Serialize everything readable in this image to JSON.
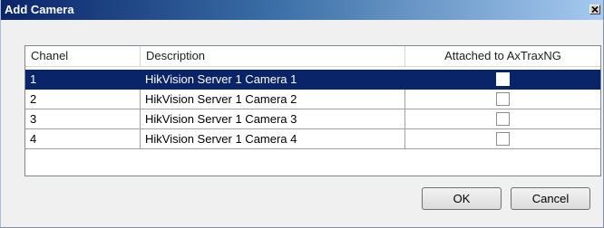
{
  "window": {
    "title": "Add Camera",
    "close_glyph": "×"
  },
  "grid": {
    "columns": [
      "Chanel",
      "Description",
      "Attached to AxTraxNG"
    ],
    "rows": [
      {
        "channel": "1",
        "description": "HikVision Server 1 Camera 1",
        "attached": false,
        "selected": true
      },
      {
        "channel": "2",
        "description": "HikVision Server 1 Camera 2",
        "attached": false,
        "selected": false
      },
      {
        "channel": "3",
        "description": "HikVision Server 1 Camera 3",
        "attached": false,
        "selected": false
      },
      {
        "channel": "4",
        "description": "HikVision Server 1 Camera 4",
        "attached": false,
        "selected": false
      }
    ]
  },
  "buttons": {
    "ok_label": "OK",
    "cancel_label": "Cancel"
  },
  "colors": {
    "title_bar_start": "#0a246a",
    "title_bar_end": "#a6caf0",
    "selection": "#0a246a",
    "dialog_background": "#f0f0f0"
  }
}
